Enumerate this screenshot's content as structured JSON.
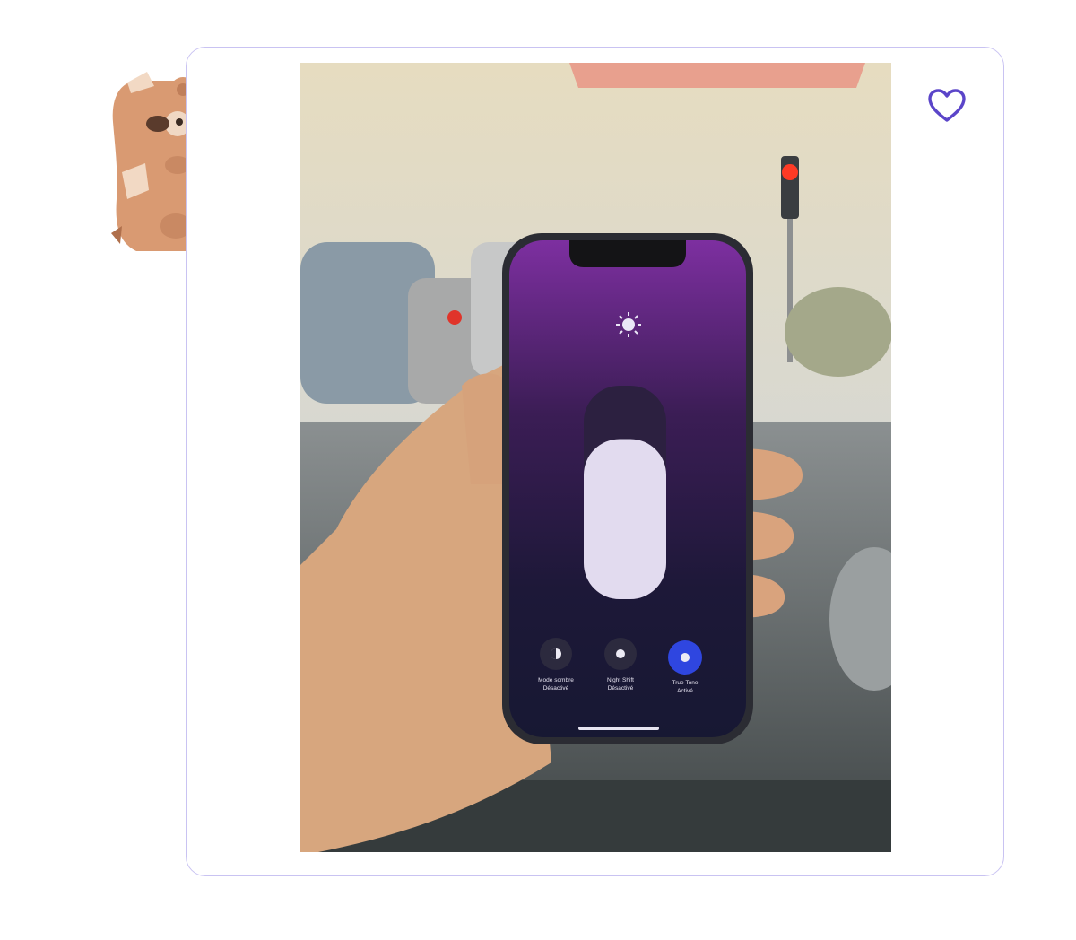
{
  "actions": {
    "favorite_icon": "heart-outline-icon"
  },
  "mascot": {
    "icon": "bear-peeking-icon"
  },
  "photo": {
    "phone_controls": [
      {
        "icon": "dark-mode-icon",
        "title": "Mode sombre",
        "state": "Désactivé"
      },
      {
        "icon": "night-shift-icon",
        "title": "Night Shift",
        "state": "Désactivé"
      },
      {
        "icon": "true-tone-icon",
        "title": "True Tone",
        "state": "Activé"
      }
    ],
    "brightness_level": 0.75
  },
  "colors": {
    "accent": "#5b45c9",
    "card_border": "#c9c3f2",
    "true_tone_active": "#2f46e0"
  }
}
